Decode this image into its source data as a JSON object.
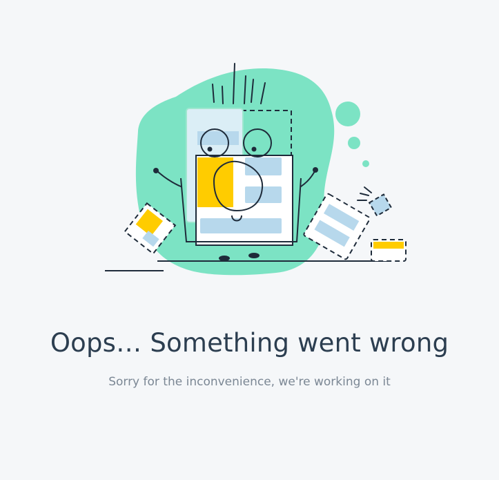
{
  "error": {
    "title": "Oops… Something went wrong",
    "subtitle": "Sorry for the inconvenience, we're working on it"
  },
  "illustration": {
    "icon": "broken-document-illustration",
    "colors": {
      "blob": "#7ce3c4",
      "panel_light": "#dbeef6",
      "panel_blue": "#b7d8ec",
      "accent_yellow": "#ffcc00",
      "stroke": "#1e2b3a",
      "background": "#f5f7f9"
    }
  }
}
